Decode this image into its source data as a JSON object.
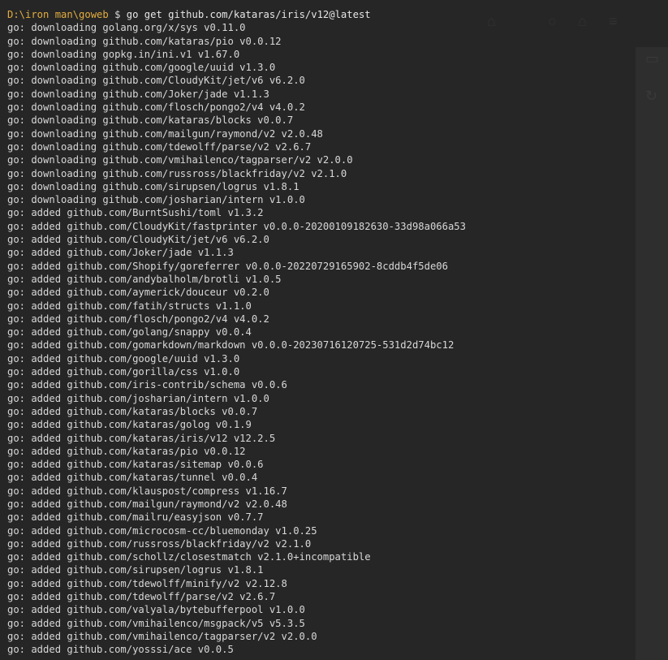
{
  "terminal": {
    "prompt_path": "D:\\iron man\\goweb",
    "prompt_symbol": "$",
    "command": "go get github.com/kataras/iris/v12@latest",
    "output_lines": [
      "go: downloading golang.org/x/sys v0.11.0",
      "go: downloading github.com/kataras/pio v0.0.12",
      "go: downloading gopkg.in/ini.v1 v1.67.0",
      "go: downloading github.com/google/uuid v1.3.0",
      "go: downloading github.com/CloudyKit/jet/v6 v6.2.0",
      "go: downloading github.com/Joker/jade v1.1.3",
      "go: downloading github.com/flosch/pongo2/v4 v4.0.2",
      "go: downloading github.com/kataras/blocks v0.0.7",
      "go: downloading github.com/mailgun/raymond/v2 v2.0.48",
      "go: downloading github.com/tdewolff/parse/v2 v2.6.7",
      "go: downloading github.com/vmihailenco/tagparser/v2 v2.0.0",
      "go: downloading github.com/russross/blackfriday/v2 v2.1.0",
      "go: downloading github.com/sirupsen/logrus v1.8.1",
      "go: downloading github.com/josharian/intern v1.0.0",
      "go: added github.com/BurntSushi/toml v1.3.2",
      "go: added github.com/CloudyKit/fastprinter v0.0.0-20200109182630-33d98a066a53",
      "go: added github.com/CloudyKit/jet/v6 v6.2.0",
      "go: added github.com/Joker/jade v1.1.3",
      "go: added github.com/Shopify/goreferrer v0.0.0-20220729165902-8cddb4f5de06",
      "go: added github.com/andybalholm/brotli v1.0.5",
      "go: added github.com/aymerick/douceur v0.2.0",
      "go: added github.com/fatih/structs v1.1.0",
      "go: added github.com/flosch/pongo2/v4 v4.0.2",
      "go: added github.com/golang/snappy v0.0.4",
      "go: added github.com/gomarkdown/markdown v0.0.0-20230716120725-531d2d74bc12",
      "go: added github.com/google/uuid v1.3.0",
      "go: added github.com/gorilla/css v1.0.0",
      "go: added github.com/iris-contrib/schema v0.0.6",
      "go: added github.com/josharian/intern v1.0.0",
      "go: added github.com/kataras/blocks v0.0.7",
      "go: added github.com/kataras/golog v0.1.9",
      "go: added github.com/kataras/iris/v12 v12.2.5",
      "go: added github.com/kataras/pio v0.0.12",
      "go: added github.com/kataras/sitemap v0.0.6",
      "go: added github.com/kataras/tunnel v0.0.4",
      "go: added github.com/klauspost/compress v1.16.7",
      "go: added github.com/mailgun/raymond/v2 v2.0.48",
      "go: added github.com/mailru/easyjson v0.7.7",
      "go: added github.com/microcosm-cc/bluemonday v1.0.25",
      "go: added github.com/russross/blackfriday/v2 v2.1.0",
      "go: added github.com/schollz/closestmatch v2.1.0+incompatible",
      "go: added github.com/sirupsen/logrus v1.8.1",
      "go: added github.com/tdewolff/minify/v2 v2.12.8",
      "go: added github.com/tdewolff/parse/v2 v2.6.7",
      "go: added github.com/valyala/bytebufferpool v1.0.0",
      "go: added github.com/vmihailenco/msgpack/v5 v5.3.5",
      "go: added github.com/vmihailenco/tagparser/v2 v2.0.0",
      "go: added github.com/yosssi/ace v0.0.5"
    ]
  },
  "colors": {
    "background": "#262626",
    "prompt_path": "#e3ad3f",
    "text": "#d8d8d8"
  }
}
